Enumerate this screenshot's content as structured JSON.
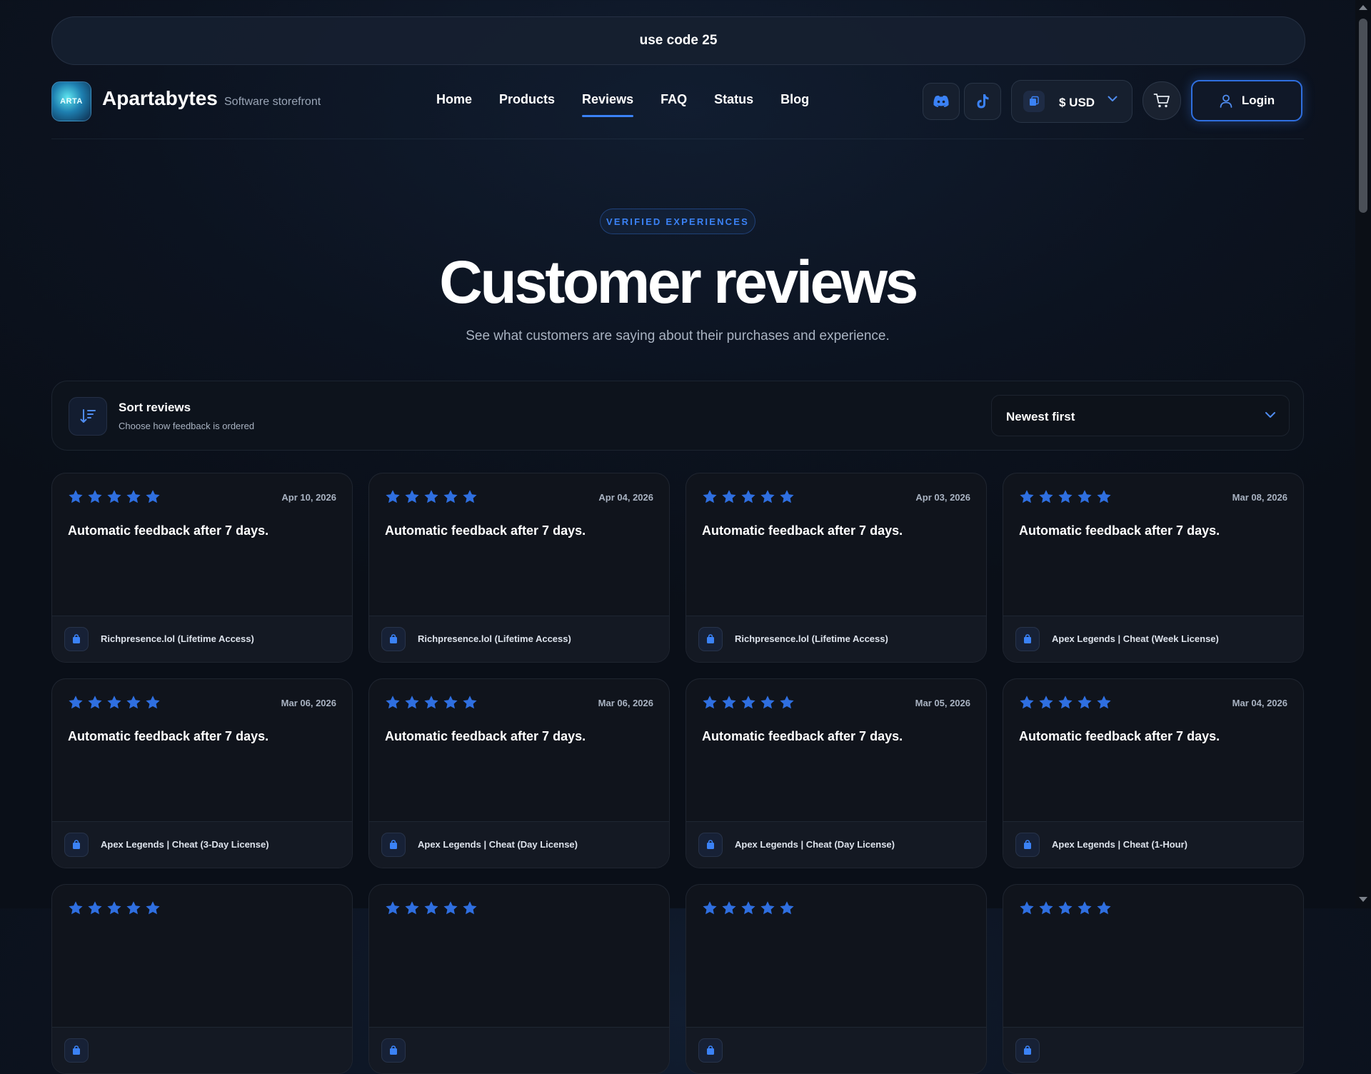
{
  "announcement": "use code 25",
  "brand": {
    "logo_text": "ARTA",
    "name": "Apartabytes",
    "tagline": "Software storefront"
  },
  "nav": [
    {
      "label": "Home",
      "active": false
    },
    {
      "label": "Products",
      "active": false
    },
    {
      "label": "Reviews",
      "active": true
    },
    {
      "label": "FAQ",
      "active": false
    },
    {
      "label": "Status",
      "active": false
    },
    {
      "label": "Blog",
      "active": false
    }
  ],
  "header_actions": {
    "icons": [
      "discord-icon",
      "tiktok-icon",
      "currency-icon",
      "cart-icon",
      "user-icon"
    ],
    "currency": "$ USD",
    "login": "Login"
  },
  "hero": {
    "badge": "VERIFIED EXPERIENCES",
    "title": "Customer reviews",
    "subtitle": "See what customers are saying about their purchases and experience."
  },
  "sort": {
    "title": "Sort reviews",
    "description": "Choose how feedback is ordered",
    "selected": "Newest first"
  },
  "colors": {
    "accent": "#3b82f6",
    "star": "#2f6fe0",
    "background": "#0c1320",
    "card": "#10141c"
  },
  "reviews": [
    {
      "rating": 5,
      "date": "Apr 10, 2026",
      "text": "Automatic feedback after 7 days.",
      "product": "Richpresence.lol (Lifetime Access)"
    },
    {
      "rating": 5,
      "date": "Apr 04, 2026",
      "text": "Automatic feedback after 7 days.",
      "product": "Richpresence.lol (Lifetime Access)"
    },
    {
      "rating": 5,
      "date": "Apr 03, 2026",
      "text": "Automatic feedback after 7 days.",
      "product": "Richpresence.lol (Lifetime Access)"
    },
    {
      "rating": 5,
      "date": "Mar 08, 2026",
      "text": "Automatic feedback after 7 days.",
      "product": "Apex Legends | Cheat (Week License)"
    },
    {
      "rating": 5,
      "date": "Mar 06, 2026",
      "text": "Automatic feedback after 7 days.",
      "product": "Apex Legends | Cheat (3-Day License)"
    },
    {
      "rating": 5,
      "date": "Mar 06, 2026",
      "text": "Automatic feedback after 7 days.",
      "product": "Apex Legends | Cheat (Day License)"
    },
    {
      "rating": 5,
      "date": "Mar 05, 2026",
      "text": "Automatic feedback after 7 days.",
      "product": "Apex Legends | Cheat (Day License)"
    },
    {
      "rating": 5,
      "date": "Mar 04, 2026",
      "text": "Automatic feedback after 7 days.",
      "product": "Apex Legends | Cheat (1-Hour)"
    },
    {
      "rating": 5,
      "date": "",
      "text": "",
      "product": ""
    },
    {
      "rating": 5,
      "date": "",
      "text": "",
      "product": ""
    },
    {
      "rating": 5,
      "date": "",
      "text": "",
      "product": ""
    },
    {
      "rating": 5,
      "date": "",
      "text": "",
      "product": ""
    }
  ]
}
